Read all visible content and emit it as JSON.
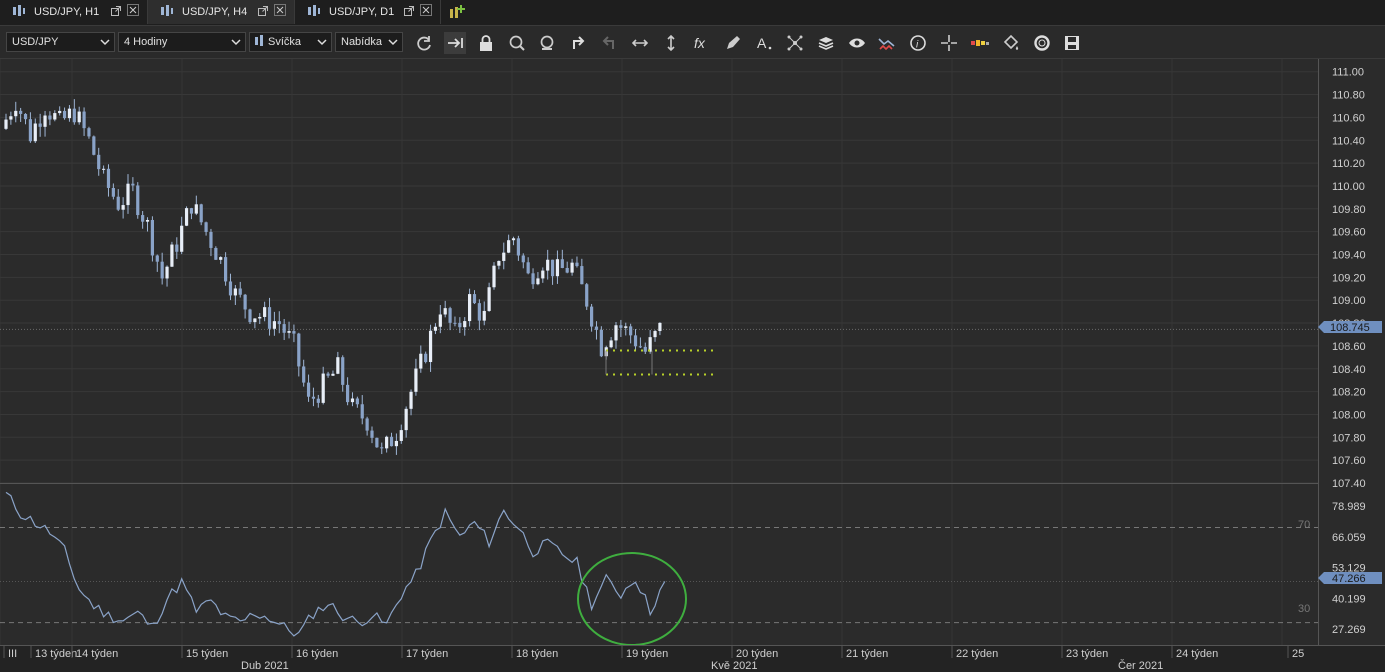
{
  "tabs": [
    {
      "label": "USD/JPY, H1",
      "active": false
    },
    {
      "label": "USD/JPY, H4",
      "active": true
    },
    {
      "label": "USD/JPY, D1",
      "active": false
    }
  ],
  "toolbar": {
    "symbol": "USD/JPY",
    "timeframe": "4 Hodiny",
    "chart_type": "Svíčka",
    "menu": "Nabídka",
    "icons": [
      "refresh-icon",
      "autoscroll-icon",
      "lock-icon",
      "zoom-in-icon",
      "zoom-out-icon",
      "undo-icon",
      "redo-icon",
      "horizontal-scale-icon",
      "vertical-scale-icon",
      "function-icon",
      "pencil-icon",
      "text-tool-icon",
      "objects-icon",
      "layers-icon",
      "eye-icon",
      "compare-icon",
      "info-icon",
      "crosshair-icon",
      "volume-bar-icon",
      "paint-icon",
      "settings-ring-icon",
      "save-icon"
    ]
  },
  "colors": {
    "background": "#2b2b2b",
    "grid": "#3a3a3a",
    "candle": "#9fb6d6",
    "rsi_line": "#8aa3c8",
    "price_tag": "#6f8fbf",
    "support_line": "#b8d22a",
    "highlight_circle": "#3fae3f"
  },
  "price_axis": {
    "ticks": [
      "111.00",
      "110.80",
      "110.60",
      "110.40",
      "110.20",
      "110.00",
      "109.80",
      "109.60",
      "109.40",
      "109.20",
      "109.00",
      "108.80",
      "108.60",
      "108.40",
      "108.20",
      "108.00",
      "107.80",
      "107.60",
      "107.40"
    ],
    "current_price": "108.745"
  },
  "rsi_axis": {
    "ticks": [
      "78.989",
      "66.059",
      "53.129",
      "40.199",
      "27.269"
    ],
    "current_value": "47.266",
    "level_high": "70",
    "level_low": "30"
  },
  "time_axis": {
    "weeks": [
      "III",
      "13 týden",
      "14 týden",
      "15 týden",
      "16 týden",
      "17 týden",
      "18 týden",
      "19 týden",
      "20 týden",
      "21 týden",
      "22 týden",
      "23 týden",
      "24 týden",
      "25"
    ],
    "months": [
      "Dub 2021",
      "Kvě 2021",
      "Čer 2021"
    ]
  },
  "chart_data": [
    {
      "type": "candlestick",
      "title": "",
      "ylim": [
        107.4,
        111.05
      ],
      "support_levels": [
        108.56,
        108.35
      ],
      "current_price": 108.745,
      "close_path": [
        {
          "x": 0,
          "y": 110.5
        },
        {
          "x": 3,
          "y": 110.75
        },
        {
          "x": 6,
          "y": 110.45
        },
        {
          "x": 9,
          "y": 110.7
        },
        {
          "x": 12,
          "y": 110.55
        },
        {
          "x": 15,
          "y": 110.65
        },
        {
          "x": 18,
          "y": 110.4
        },
        {
          "x": 21,
          "y": 110.05
        },
        {
          "x": 24,
          "y": 109.85
        },
        {
          "x": 27,
          "y": 109.95
        },
        {
          "x": 30,
          "y": 109.65
        },
        {
          "x": 33,
          "y": 109.2
        },
        {
          "x": 36,
          "y": 109.5
        },
        {
          "x": 39,
          "y": 109.85
        },
        {
          "x": 42,
          "y": 109.6
        },
        {
          "x": 45,
          "y": 109.35
        },
        {
          "x": 48,
          "y": 109.05
        },
        {
          "x": 51,
          "y": 108.9
        },
        {
          "x": 54,
          "y": 108.85
        },
        {
          "x": 57,
          "y": 108.8
        },
        {
          "x": 60,
          "y": 108.6
        },
        {
          "x": 63,
          "y": 108.1
        },
        {
          "x": 66,
          "y": 108.25
        },
        {
          "x": 69,
          "y": 108.4
        },
        {
          "x": 72,
          "y": 108.05
        },
        {
          "x": 75,
          "y": 107.95
        },
        {
          "x": 78,
          "y": 107.65
        },
        {
          "x": 81,
          "y": 107.85
        },
        {
          "x": 84,
          "y": 108.2
        },
        {
          "x": 87,
          "y": 108.55
        },
        {
          "x": 90,
          "y": 108.95
        },
        {
          "x": 93,
          "y": 108.7
        },
        {
          "x": 96,
          "y": 109.0
        },
        {
          "x": 99,
          "y": 108.85
        },
        {
          "x": 102,
          "y": 109.4
        },
        {
          "x": 105,
          "y": 109.55
        },
        {
          "x": 108,
          "y": 109.2
        },
        {
          "x": 111,
          "y": 109.35
        },
        {
          "x": 114,
          "y": 109.25
        },
        {
          "x": 117,
          "y": 109.3
        },
        {
          "x": 120,
          "y": 109.0
        },
        {
          "x": 123,
          "y": 108.6
        },
        {
          "x": 126,
          "y": 108.8
        },
        {
          "x": 129,
          "y": 108.7
        },
        {
          "x": 132,
          "y": 108.55
        },
        {
          "x": 135,
          "y": 108.745
        }
      ]
    },
    {
      "type": "line",
      "title": "",
      "ylim": [
        21,
        87
      ],
      "levels": [
        70,
        30
      ],
      "current_value": 47.266,
      "points": [
        {
          "x": 0,
          "y": 84
        },
        {
          "x": 3,
          "y": 76
        },
        {
          "x": 6,
          "y": 72
        },
        {
          "x": 9,
          "y": 68
        },
        {
          "x": 12,
          "y": 60
        },
        {
          "x": 15,
          "y": 44
        },
        {
          "x": 18,
          "y": 37
        },
        {
          "x": 21,
          "y": 33
        },
        {
          "x": 24,
          "y": 31
        },
        {
          "x": 27,
          "y": 34
        },
        {
          "x": 30,
          "y": 28
        },
        {
          "x": 33,
          "y": 40
        },
        {
          "x": 36,
          "y": 47
        },
        {
          "x": 39,
          "y": 35
        },
        {
          "x": 42,
          "y": 39
        },
        {
          "x": 45,
          "y": 32
        },
        {
          "x": 48,
          "y": 30
        },
        {
          "x": 51,
          "y": 34
        },
        {
          "x": 54,
          "y": 32
        },
        {
          "x": 57,
          "y": 28
        },
        {
          "x": 60,
          "y": 25
        },
        {
          "x": 63,
          "y": 34
        },
        {
          "x": 66,
          "y": 38
        },
        {
          "x": 69,
          "y": 33
        },
        {
          "x": 72,
          "y": 30
        },
        {
          "x": 75,
          "y": 33
        },
        {
          "x": 78,
          "y": 29
        },
        {
          "x": 81,
          "y": 42
        },
        {
          "x": 84,
          "y": 50
        },
        {
          "x": 87,
          "y": 64
        },
        {
          "x": 90,
          "y": 76
        },
        {
          "x": 93,
          "y": 66
        },
        {
          "x": 96,
          "y": 72
        },
        {
          "x": 99,
          "y": 64
        },
        {
          "x": 102,
          "y": 77
        },
        {
          "x": 105,
          "y": 70
        },
        {
          "x": 108,
          "y": 60
        },
        {
          "x": 111,
          "y": 63
        },
        {
          "x": 114,
          "y": 59
        },
        {
          "x": 117,
          "y": 55
        },
        {
          "x": 120,
          "y": 38
        },
        {
          "x": 123,
          "y": 48
        },
        {
          "x": 126,
          "y": 42
        },
        {
          "x": 129,
          "y": 49
        },
        {
          "x": 132,
          "y": 35
        },
        {
          "x": 135,
          "y": 47.3
        }
      ]
    }
  ]
}
